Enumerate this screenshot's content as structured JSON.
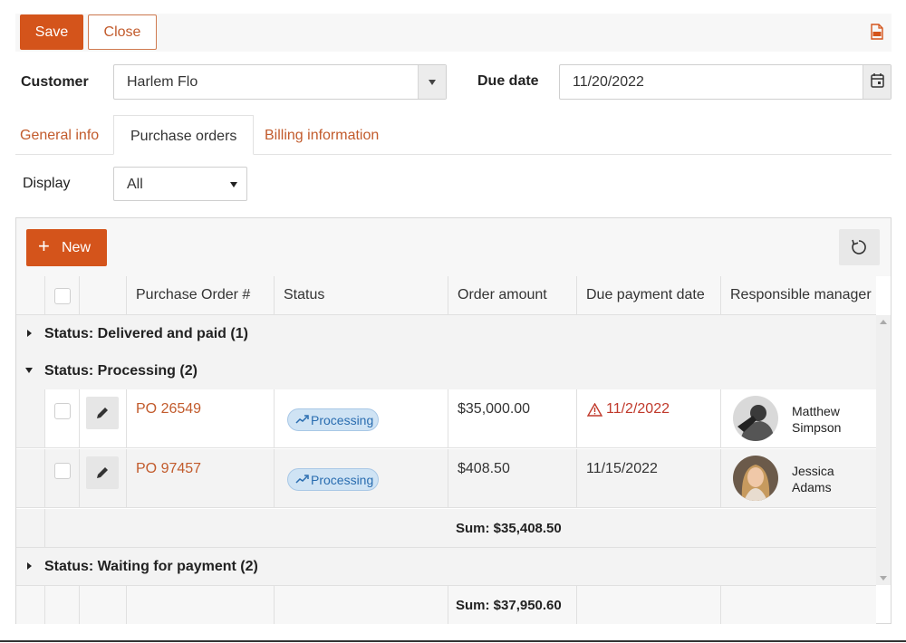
{
  "toolbar": {
    "save_label": "Save",
    "close_label": "Close",
    "pdf_icon": "pdf-icon"
  },
  "form": {
    "customer_label": "Customer",
    "customer_value": "Harlem Flo",
    "due_date_label": "Due date",
    "due_date_value": "11/20/2022",
    "display_label": "Display",
    "display_value": "All"
  },
  "tabs": [
    {
      "label": "General info",
      "active": false
    },
    {
      "label": "Purchase orders",
      "active": true
    },
    {
      "label": "Billing information",
      "active": false
    }
  ],
  "grid": {
    "new_label": "New",
    "columns": [
      "Purchase Order #",
      "Status",
      "Order amount",
      "Due payment date",
      "Responsible manager"
    ],
    "groups": [
      {
        "title": "Status: Delivered and paid (1)",
        "expanded": false
      },
      {
        "title": "Status: Processing (2)",
        "expanded": true
      },
      {
        "title": "Status: Waiting for payment (2)",
        "expanded": false
      }
    ],
    "rows": [
      {
        "po": "PO 26549",
        "status": "Processing",
        "amount": "$35,000.00",
        "due": "11/2/2022",
        "overdue": true,
        "manager_first": "Matthew",
        "manager_last": "Simpson"
      },
      {
        "po": "PO 97457",
        "status": "Processing",
        "amount": "$408.50",
        "due": "11/15/2022",
        "overdue": false,
        "manager_first": "Jessica",
        "manager_last": "Adams"
      }
    ],
    "group_sum": "Sum: $35,408.50",
    "total_sum": "Sum: $37,950.60"
  },
  "colors": {
    "accent": "#d4541b",
    "link": "#c25b2c",
    "badge_bg": "#cfe3f4",
    "overdue": "#c0392b"
  }
}
